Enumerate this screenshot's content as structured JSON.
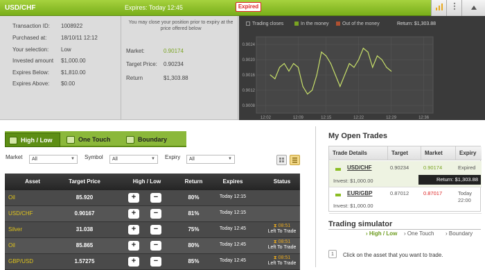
{
  "header": {
    "symbol": "USD/CHF",
    "expires": "Expires: Today 12:45",
    "status_badge": "Expired"
  },
  "trade_info": {
    "rows": [
      {
        "label": "Transaction ID:",
        "value": "1008922"
      },
      {
        "label": "Purchased at:",
        "value": "18/10/11 12:12"
      },
      {
        "label": "Your selection:",
        "value": "Low"
      },
      {
        "label": "Invested amount",
        "value": "$1,000.00"
      },
      {
        "label": "Expires Below:",
        "value": "$1,810.00"
      },
      {
        "label": "Expires Above:",
        "value": "$0.00"
      }
    ],
    "note": "You may close your position prior to expiry at the price offered below",
    "market_label": "Market:",
    "market_value": "0.90174",
    "target_label": "Target Price:",
    "target_value": "0.90234",
    "return_label": "Return",
    "return_value": "$1,303.88"
  },
  "chart_data": {
    "type": "line",
    "legend": [
      "Trading closes",
      "In the money",
      "Out of the money"
    ],
    "return_text": "Return: $1,303.88",
    "y_ticks": [
      "0.9024",
      "0.9020",
      "0.9016",
      "0.9012",
      "0.9008"
    ],
    "x_ticks": [
      "12:02",
      "12:09",
      "12:15",
      "12:22",
      "12:29",
      "12:36"
    ],
    "ylim": [
      0.9006,
      0.9026
    ],
    "x": [
      12.03,
      12.04,
      12.05,
      12.06,
      12.07,
      12.08,
      12.09,
      12.1,
      12.11,
      12.12,
      12.13,
      12.14,
      12.15,
      12.16,
      12.17,
      12.18,
      12.19,
      12.2,
      12.21,
      12.22,
      12.23,
      12.24,
      12.25,
      12.26,
      12.27,
      12.28,
      12.29
    ],
    "values": [
      0.9016,
      0.9015,
      0.9018,
      0.9019,
      0.9017,
      0.9019,
      0.9018,
      0.9013,
      0.9011,
      0.9012,
      0.9016,
      0.9022,
      0.9021,
      0.9019,
      0.9016,
      0.9013,
      0.9016,
      0.9019,
      0.9018,
      0.902,
      0.9023,
      0.9022,
      0.9018,
      0.9021,
      0.902,
      0.9018,
      0.9017
    ],
    "colors": {
      "line": "#c8e06a",
      "bg": "#3a3a3a",
      "grid": "#575757"
    }
  },
  "tabs": [
    {
      "label": "High / Low"
    },
    {
      "label": "One Touch"
    },
    {
      "label": "Boundary"
    }
  ],
  "filters": {
    "market_label": "Market",
    "market_value": "All",
    "symbol_label": "Symbol",
    "symbol_value": "All",
    "expiry_label": "Expiry",
    "expiry_value": "All"
  },
  "table": {
    "headers": [
      "Asset",
      "Target Price",
      "High / Low",
      "Return",
      "Expires",
      "Status"
    ],
    "rows": [
      {
        "asset": "Oil",
        "price": "85.920",
        "return": "80%",
        "expires": "Today 12:15",
        "timer": "",
        "status": ""
      },
      {
        "asset": "USD/CHF",
        "price": "0.90167",
        "return": "81%",
        "expires": "Today 12:15",
        "timer": "",
        "status": ""
      },
      {
        "asset": "Silver",
        "price": "31.038",
        "return": "75%",
        "expires": "Today 12:45",
        "timer": "08:51",
        "status": "Left To Trade"
      },
      {
        "asset": "Oil",
        "price": "85.865",
        "return": "80%",
        "expires": "Today 12:45",
        "timer": "08:51",
        "status": "Left To Trade"
      },
      {
        "asset": "GBP/USD",
        "price": "1.57275",
        "return": "85%",
        "expires": "Today 12:45",
        "timer": "08:51",
        "status": "Left To Trade"
      }
    ]
  },
  "open_trades": {
    "title": "My Open Trades",
    "headers": [
      "Trade Details",
      "Target",
      "Market",
      "Expiry"
    ],
    "rows": [
      {
        "pair": "USD/CHF",
        "invest": "Invest: $1,000.00",
        "target": "0.90234",
        "market": "0.90174",
        "expiry": "Expired",
        "return": "Return: $1,303.88"
      },
      {
        "pair": "EUR/GBP",
        "invest": "Invest: $1,000.00",
        "target": "0.87012",
        "market": "0.87017",
        "expiry": "Today 22:00"
      }
    ]
  },
  "simulator": {
    "title": "Trading simulator",
    "tabs": [
      "High / Low",
      "One Touch",
      "Boundary"
    ],
    "step_number": "1",
    "step_text": "Click on the asset that you want to trade."
  }
}
